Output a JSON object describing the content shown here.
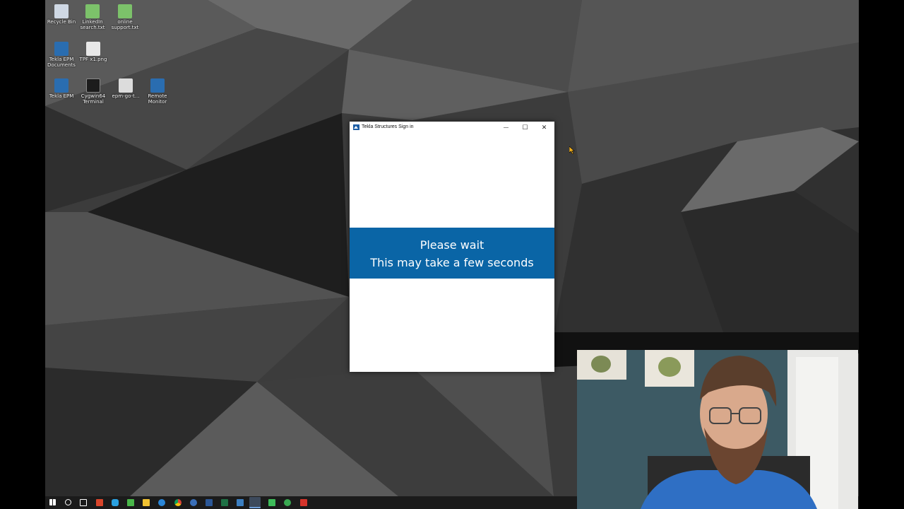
{
  "desktop_icons": [
    {
      "label": "Recycle Bin",
      "icon": "recycle-bin-icon",
      "color": "#cfd8e4"
    },
    {
      "label": "LinkedIn\nsearch.txt",
      "icon": "text-file-icon",
      "color": "#7cc26a"
    },
    {
      "label": "online\nsupport.txt",
      "icon": "text-file-icon",
      "color": "#7cc26a"
    },
    {
      "label": "Tekla EPM\nDocuments",
      "icon": "tekla-epm-documents-icon",
      "color": "#2a6db0"
    },
    {
      "label": "TPF x1.png",
      "icon": "png-file-icon",
      "color": "#e8e8e8"
    },
    {
      "label": "Tekla EPM",
      "icon": "tekla-epm-icon",
      "color": "#2a6db0"
    },
    {
      "label": "Cygwin64\nTerminal",
      "icon": "cygwin-terminal-icon",
      "color": "#1c1c1c"
    },
    {
      "label": "epm-go-t...",
      "icon": "epm-go-file-icon",
      "color": "#dcdcdc"
    },
    {
      "label": "Remote\nMonitor",
      "icon": "remote-monitor-icon",
      "color": "#2a6db0"
    }
  ],
  "window": {
    "title": "Tekla Structures Sign in",
    "minimize_glyph": "—",
    "maximize_glyph": "☐",
    "close_glyph": "✕",
    "banner_line1": "Please wait",
    "banner_line2": "This may take a few seconds",
    "accent_color": "#0a65a6"
  },
  "taskbar": {
    "items": [
      {
        "name": "start-button",
        "color": "#ffffff"
      },
      {
        "name": "search-icon",
        "color": "#ffffff"
      },
      {
        "name": "task-view-icon",
        "color": "#ffffff"
      },
      {
        "name": "app-red-icon",
        "color": "#d9452b"
      },
      {
        "name": "app-skype-icon",
        "color": "#2aa0e0"
      },
      {
        "name": "app-green-icon",
        "color": "#49b649"
      },
      {
        "name": "file-explorer-icon",
        "color": "#f1c232"
      },
      {
        "name": "edge-icon",
        "color": "#2a86d8"
      },
      {
        "name": "chrome-icon",
        "color": "#e8c23a"
      },
      {
        "name": "app-blue-icon",
        "color": "#3a6fb8"
      },
      {
        "name": "word-icon",
        "color": "#2b5797"
      },
      {
        "name": "excel-icon",
        "color": "#1e7145"
      },
      {
        "name": "app-terminal-icon",
        "color": "#3c7fc1"
      },
      {
        "name": "tekla-active-icon",
        "color": "#6d9ed8"
      },
      {
        "name": "app-green2-icon",
        "color": "#3ebc5a"
      },
      {
        "name": "app-chrome2-icon",
        "color": "#39a851"
      },
      {
        "name": "app-red2-icon",
        "color": "#d5342b"
      }
    ]
  }
}
